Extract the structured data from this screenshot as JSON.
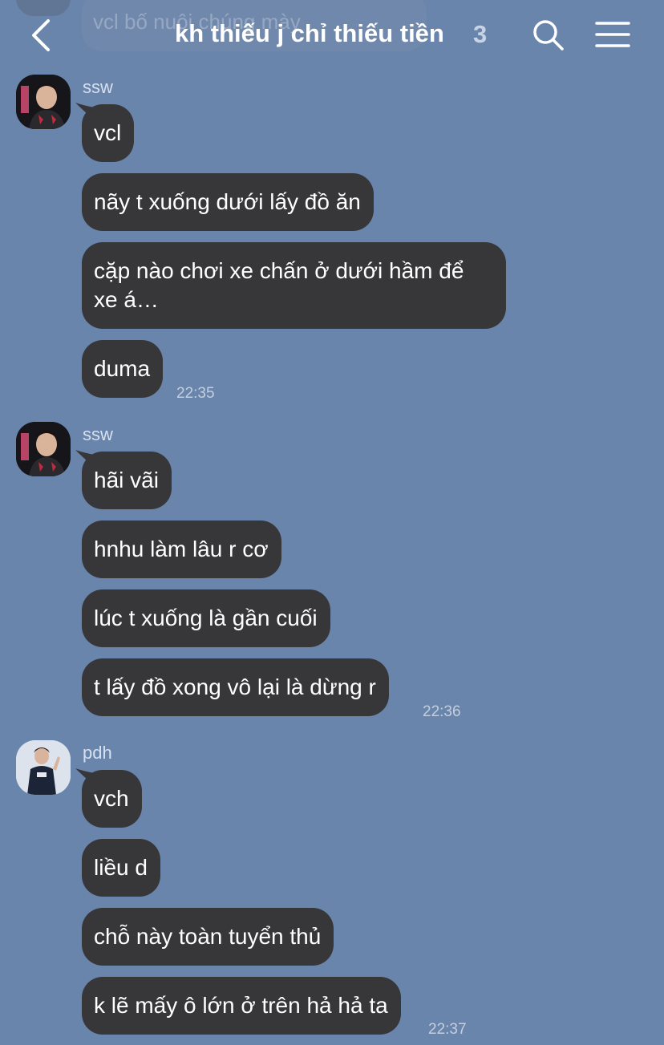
{
  "header": {
    "title": "kh thiếu j chỉ thiếu tiền",
    "member_count": "3",
    "scrolled_preview_text": "vcl bố nuôi chúng mày"
  },
  "colors": {
    "background": "#6a85ab",
    "bubble": "#373739",
    "text": "#ffffff",
    "meta_text": "#c3cfe0"
  },
  "icons": [
    "back-chevron-icon",
    "search-icon",
    "menu-icon"
  ],
  "groups": [
    {
      "sender": "ssw",
      "messages": [
        "vcl",
        "nãy t xuống dưới lấy đồ ăn",
        "cặp nào chơi xe chấn ở dưới hầm để xe á…",
        "duma"
      ],
      "time": "22:35"
    },
    {
      "sender": "ssw",
      "messages": [
        "hãi vãi",
        "hnhu làm lâu r cơ",
        "lúc t xuống là gần cuối",
        "t lấy đồ xong vô lại là dừng r"
      ],
      "time": "22:36"
    },
    {
      "sender": "pdh",
      "messages": [
        "vch",
        "liều d",
        "chỗ này toàn tuyển thủ",
        "k lẽ mấy ô lớn ở trên hả hả ta"
      ],
      "time": "22:37"
    }
  ]
}
